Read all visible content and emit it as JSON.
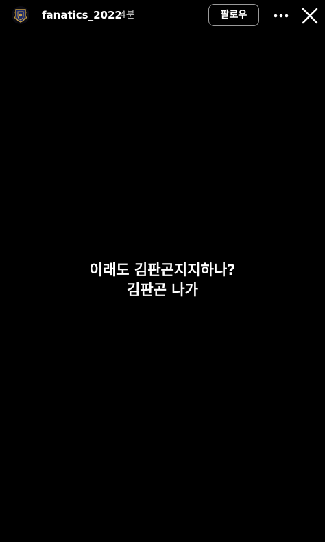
{
  "header": {
    "username": "fanatics_2022",
    "time_ago": "4분",
    "follow_label": "팔로우",
    "avatar_icon": "team-crest-icon",
    "more_icon": "more-options-icon",
    "close_icon": "close-icon"
  },
  "story": {
    "lines": [
      "이래도 김판곤지지하나?",
      "김판곤 나가"
    ]
  },
  "colors": {
    "background": "#000000",
    "text": "#ffffff",
    "secondary_text": "#b8b8b8",
    "button_border": "#9a9a9a",
    "crest_gold": "#c9a24a",
    "crest_navy": "#1c2a6b"
  }
}
